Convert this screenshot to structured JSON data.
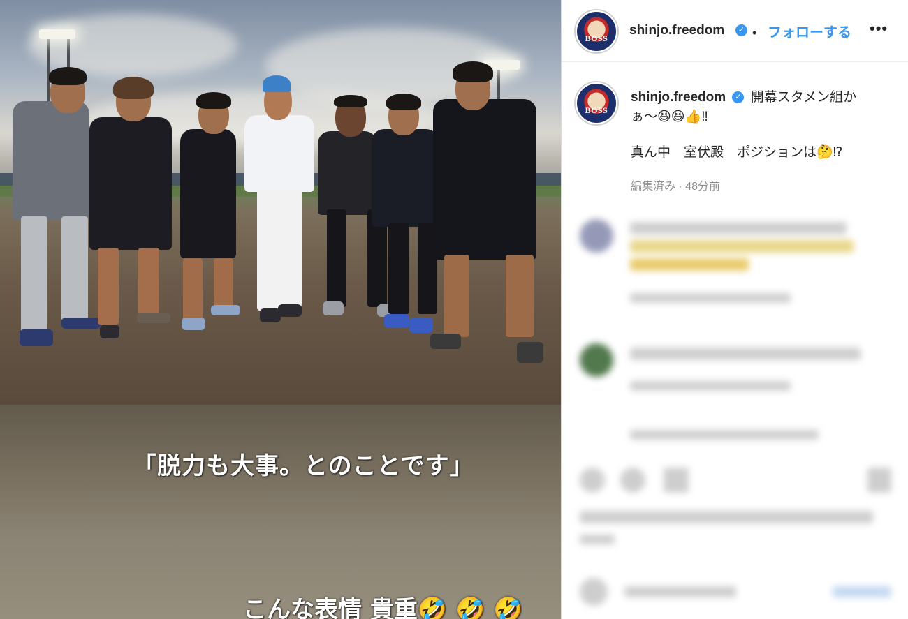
{
  "photo": {
    "caption_top": "「脱力も大事。とのことです」",
    "caption_bottom": "こんな表情 貴重🤣 🤣 🤣"
  },
  "post": {
    "header": {
      "username": "shinjo.freedom",
      "avatar_text": "BOSS",
      "follow_label": "フォローする",
      "separator": "•",
      "more_label": "•••"
    },
    "caption": {
      "username": "shinjo.freedom",
      "text_line1": "開幕スタメン組か",
      "text_line1b": "ぁ〜😆😆👍‼",
      "text_line2": "真ん中　室伏殿　ポジションは🤔⁉",
      "meta": "編集済み · 48分前"
    }
  },
  "colors": {
    "link_blue": "#3897f0",
    "text": "#262626",
    "secondary": "#8e8e8e"
  },
  "icons": [
    "verified-badge-icon",
    "more-options-icon"
  ]
}
